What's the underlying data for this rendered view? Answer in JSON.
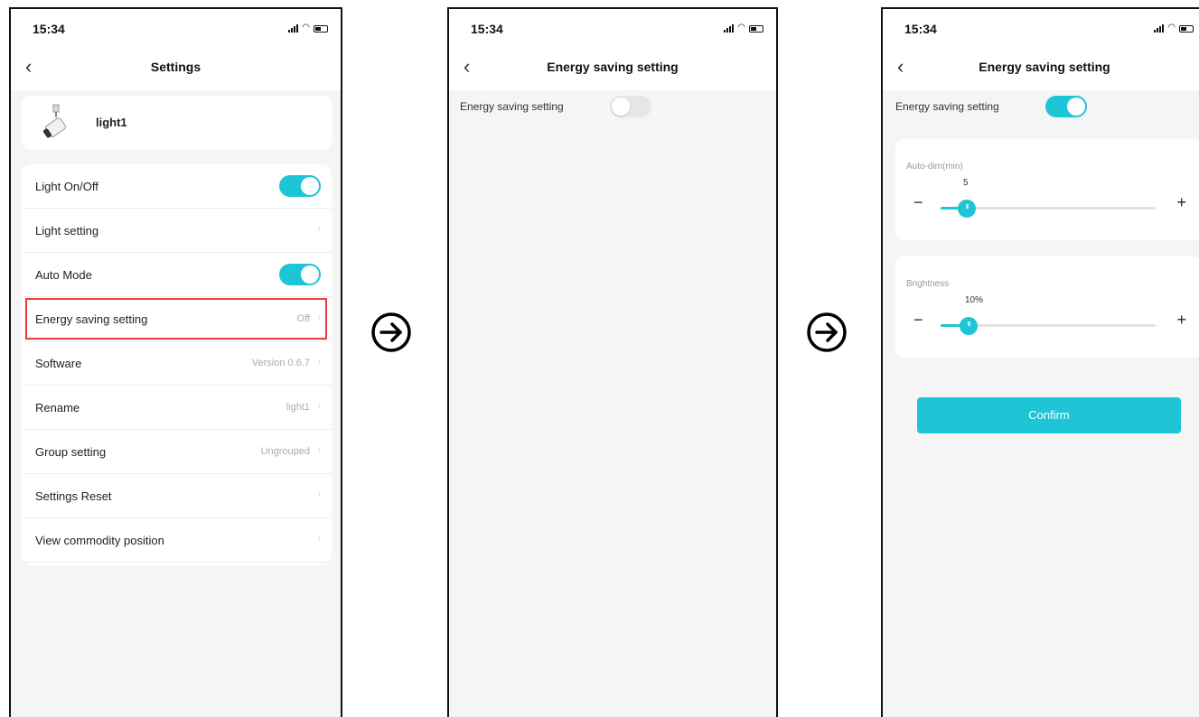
{
  "colors": {
    "accent": "#1ec5d7",
    "highlight_border": "#e83a3a",
    "background": "#f5f5f5"
  },
  "screens": [
    {
      "status": {
        "time": "15:34"
      },
      "title": "Settings",
      "device": {
        "name": "light1",
        "icon": "spotlight-icon"
      },
      "rows": [
        {
          "label": "Light On/Off",
          "toggle": true
        },
        {
          "label": "Light setting",
          "value": ""
        },
        {
          "label": "Auto Mode",
          "toggle": true
        },
        {
          "label": "Energy saving setting",
          "value": "Off",
          "highlighted": true
        },
        {
          "label": "Software",
          "value": "Version 0.6.7"
        },
        {
          "label": "Rename",
          "value": "light1"
        },
        {
          "label": "Group setting",
          "value": "Ungrouped"
        },
        {
          "label": "Settings Reset",
          "value": ""
        },
        {
          "label": "View commodity position",
          "value": ""
        }
      ],
      "arrow_glyph": "›"
    },
    {
      "status": {
        "time": "15:34"
      },
      "title": "Energy saving setting",
      "energy_label": "Energy saving setting",
      "energy_toggle": false
    },
    {
      "status": {
        "time": "15:34"
      },
      "title": "Energy saving setting",
      "energy_label": "Energy saving setting",
      "energy_toggle": true,
      "auto_dim": {
        "label": "Auto-dim(min)",
        "value": "5",
        "level": 0.12
      },
      "brightness": {
        "label": "Brightness",
        "value": "10%",
        "level": 0.13
      },
      "minus": "−",
      "plus": "+",
      "confirm_label": "Confirm"
    }
  ],
  "nav": {
    "back_glyph": "‹"
  }
}
